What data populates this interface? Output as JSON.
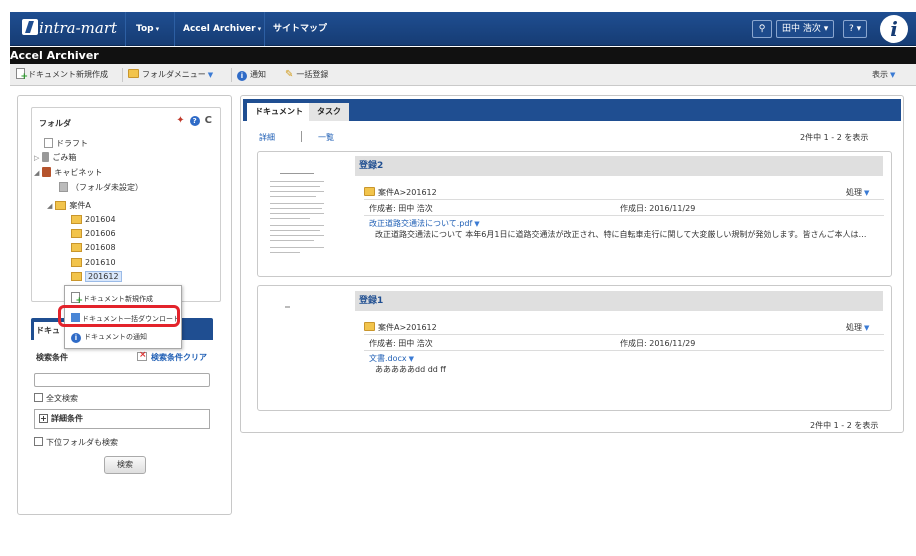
{
  "header": {
    "logo_text": "intra-mart",
    "nav": [
      {
        "label": "Top"
      },
      {
        "label": "Accel Archiver"
      },
      {
        "label": "サイトマップ"
      }
    ],
    "user_label": "田中 浩次",
    "help_label": "?"
  },
  "app_title": "Accel Archiver",
  "toolbar": {
    "new_doc": "ドキュメント新規作成",
    "folder_menu": "フォルダメニュー",
    "notify": "通知",
    "bulk_register": "一括登録",
    "display": "表示"
  },
  "folder_panel": {
    "title": "フォルダ",
    "tree": [
      {
        "label": "ドラフト"
      },
      {
        "label": "ごみ箱"
      },
      {
        "label": "キャビネット"
      },
      {
        "label": "（フォルダ未設定）"
      },
      {
        "label": "案件A"
      },
      {
        "label": "201604"
      },
      {
        "label": "201606"
      },
      {
        "label": "201608"
      },
      {
        "label": "201610"
      },
      {
        "label": "201612"
      }
    ]
  },
  "context_menu": {
    "items": [
      {
        "label": "ドキュメント新規作成"
      },
      {
        "label": "ドキュメント一括ダウンロード"
      },
      {
        "label": "ドキュメントの通知"
      }
    ]
  },
  "search_panel": {
    "tab_label": "ドキュ",
    "conditions_label": "検索条件",
    "clear_label": "検索条件クリア",
    "query_value": "",
    "fulltext_label": "全文検索",
    "detail_label": "詳細条件",
    "subfolder_label": "下位フォルダも検索",
    "search_button": "検索"
  },
  "main": {
    "tabs": [
      {
        "label": "ドキュメント"
      },
      {
        "label": "タスク"
      }
    ],
    "view_detail": "詳細",
    "view_list": "一覧",
    "count_top": "2件中 1 - 2 を表示",
    "count_bottom": "2件中 1 - 2 を表示",
    "documents": [
      {
        "title": "登録2",
        "folder": "案件A>201612",
        "action": "処理",
        "author": "作成者: 田中 浩次",
        "date": "作成日: 2016/11/29",
        "file_name": "改正道路交通法について.pdf",
        "snippet": "改正道路交通法について 本年6月1日に道路交通法が改正され、特に自転車走行に関して大変厳しい規制が発効します。皆さんご本人は…"
      },
      {
        "title": "登録1",
        "folder": "案件A>201612",
        "action": "処理",
        "author": "作成者: 田中 浩次",
        "date": "作成日: 2016/11/29",
        "file_name": "文書.docx",
        "snippet": "あああああdd dd ff"
      }
    ]
  },
  "colors": {
    "header_blue": "#1f4e91",
    "highlight_red": "#e3232b",
    "link_blue": "#1f5fb5"
  }
}
